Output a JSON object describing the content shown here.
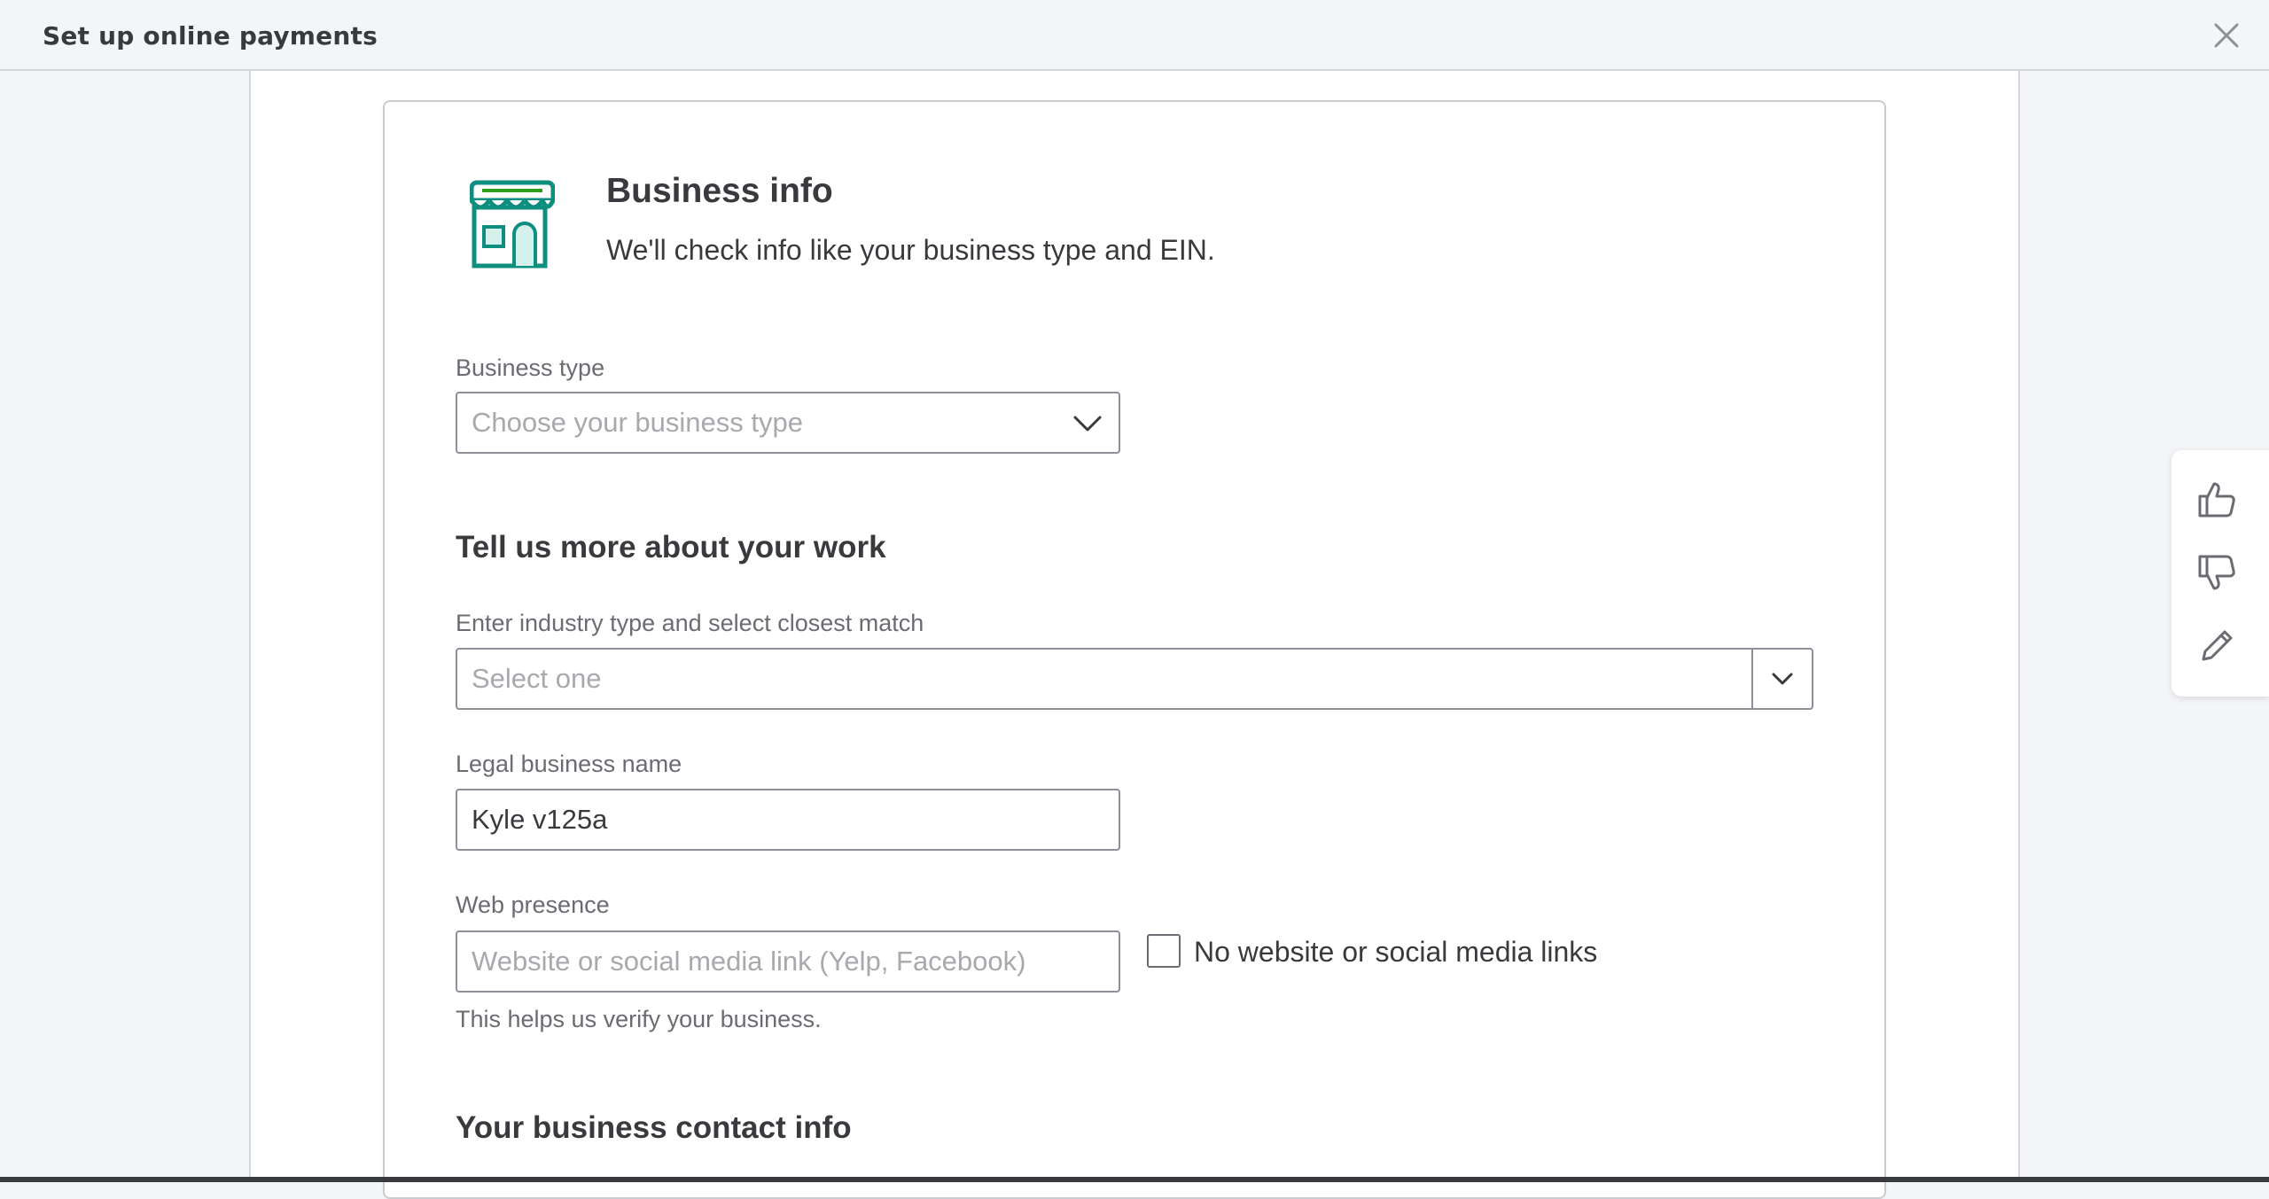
{
  "window": {
    "title": "Set up online payments",
    "close_icon": "close-icon"
  },
  "card": {
    "icon": "storefront-icon",
    "heading": "Business info",
    "subheading": "We'll check info like your business type and EIN."
  },
  "business_type": {
    "label": "Business type",
    "placeholder": "Choose your business type",
    "value": ""
  },
  "work_section": {
    "heading": "Tell us more about your work",
    "industry_label": "Enter industry type and select closest match",
    "industry_placeholder": "Select one",
    "legal_name_label": "Legal business name",
    "legal_name_value": "Kyle v125a",
    "web_label": "Web presence",
    "web_placeholder": "Website or social media link (Yelp, Facebook)",
    "web_value": "",
    "no_website_label": "No website or social media links",
    "no_website_checked": false,
    "helper_text": "This helps us verify your business."
  },
  "contact_section": {
    "heading": "Your business contact info"
  },
  "feedback": {
    "icons": [
      "thumbs-up-icon",
      "thumbs-down-icon",
      "pencil-icon"
    ]
  },
  "colors": {
    "brand_teal": "#0d8e7f",
    "brand_green": "#2ca01c",
    "text": "#393a3d",
    "muted": "#6b6c72",
    "border": "#8d9096"
  }
}
